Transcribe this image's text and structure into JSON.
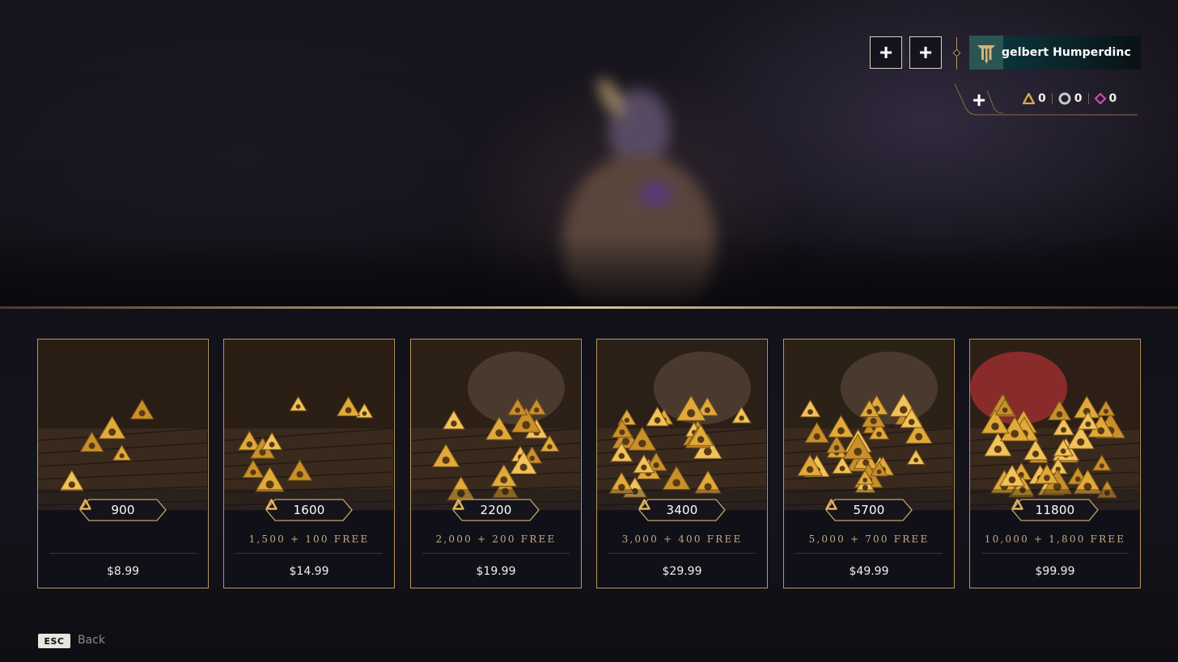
{
  "header": {
    "profile_name": "gelbert Humperdinc",
    "currencies": [
      {
        "icon": "gold-triangle-coin-icon",
        "value": "0",
        "color": "#d6a84a"
      },
      {
        "icon": "silver-ring-coin-icon",
        "value": "0",
        "color": "#c9c9c9"
      },
      {
        "icon": "pink-diamond-icon",
        "value": "0",
        "color": "#d84fb0"
      }
    ]
  },
  "offers": [
    {
      "amount": "900",
      "bonus": "",
      "price": "$8.99"
    },
    {
      "amount": "1600",
      "bonus": "1,500 + 100 FREE",
      "price": "$14.99"
    },
    {
      "amount": "2200",
      "bonus": "2,000 + 200 FREE",
      "price": "$19.99"
    },
    {
      "amount": "3400",
      "bonus": "3,000 + 400 FREE",
      "price": "$29.99"
    },
    {
      "amount": "5700",
      "bonus": "5,000 + 700 FREE",
      "price": "$49.99"
    },
    {
      "amount": "11800",
      "bonus": "10,000 + 1,800 FREE",
      "price": "$99.99"
    }
  ],
  "footer": {
    "esc_key": "ESC",
    "back_label": "Back"
  },
  "colors": {
    "accent_gold": "#b8975e",
    "card_background": "#101019",
    "profile_teal": "#0d3a42"
  }
}
